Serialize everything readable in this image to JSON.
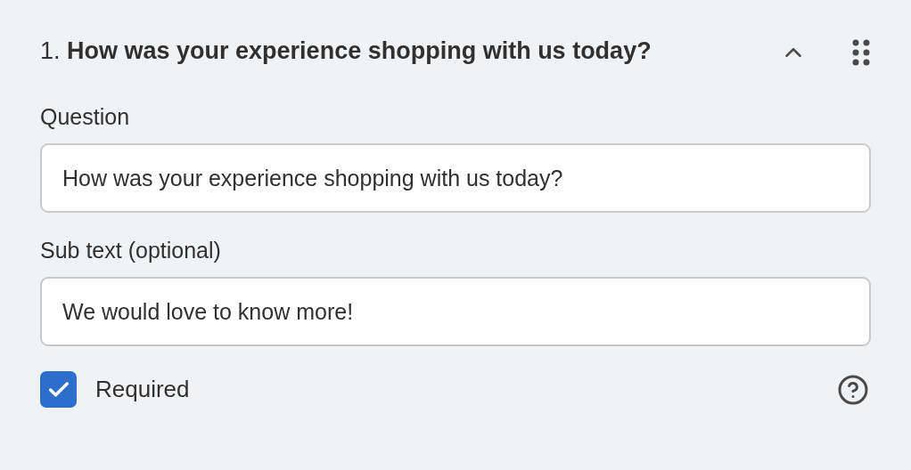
{
  "question_card": {
    "title": "1. **How was your experience shopping with us today?**",
    "expanded": true,
    "fields": [
      {
        "label": "Question",
        "value": "How was your experience shopping with us today?"
      },
      {
        "label": "Sub text (optional)",
        "value": "We would love to know more!"
      }
    ],
    "required": {
      "label": "Required",
      "checked": true
    }
  }
}
